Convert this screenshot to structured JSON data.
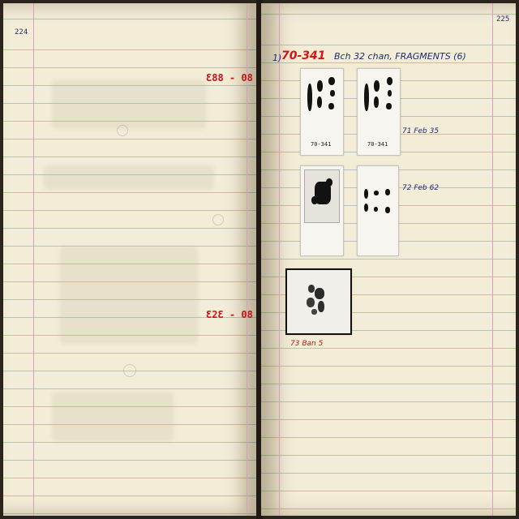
{
  "notebook": {
    "left_page": {
      "page_number": "224",
      "range_note_top": "Ɛ88 - 08",
      "range_note_bottom": "Ɛ2Ɛ - 08"
    },
    "right_page": {
      "page_number": "225",
      "entry_marker": "1)",
      "entry_id": "70-341",
      "entry_description": "Bch 32 chan, FRAGMENTS (6)",
      "photo_captions": [
        "70-341",
        "70-341"
      ],
      "note_row1": "71 Feb 35",
      "note_row2": "72 Feb 62",
      "note_framed": "73 Ban 5"
    }
  }
}
